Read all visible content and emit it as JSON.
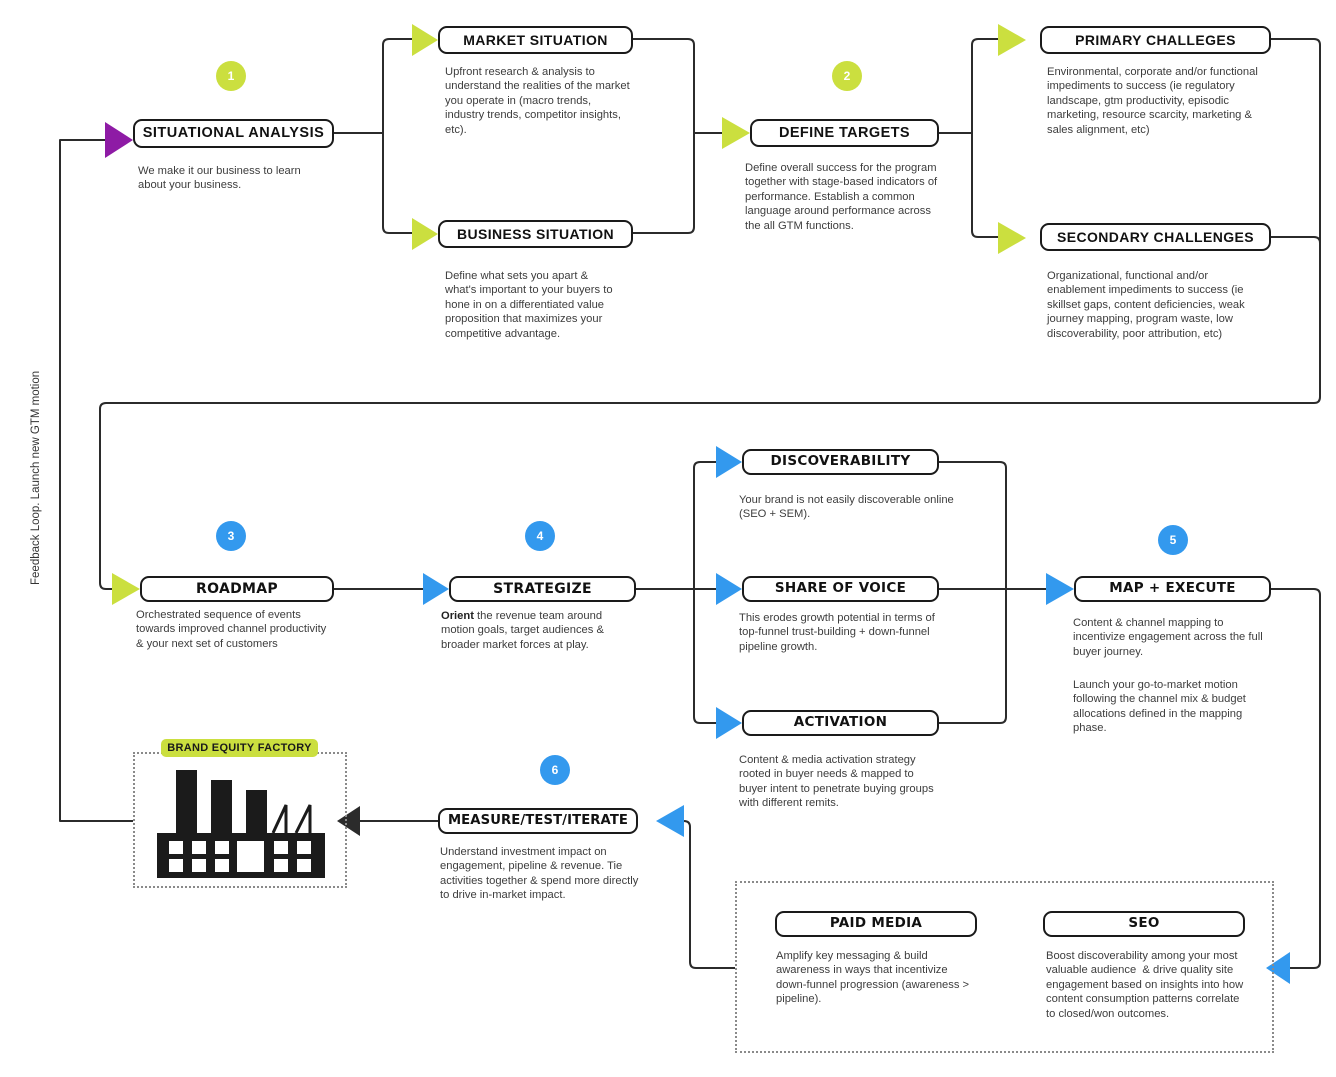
{
  "diagram": {
    "side_caption": "Feedback Loop. Launch new GTM motion",
    "accent_green": "#cbdf3f",
    "accent_blue": "#3399ee",
    "accent_purple": "#8e1ba5",
    "line_color": "#2b2b2b"
  },
  "badges": [
    {
      "id": "1",
      "label": "1",
      "color": "green"
    },
    {
      "id": "2",
      "label": "2",
      "color": "green"
    },
    {
      "id": "3",
      "label": "3",
      "color": "blue"
    },
    {
      "id": "4",
      "label": "4",
      "color": "blue"
    },
    {
      "id": "5",
      "label": "5",
      "color": "blue"
    },
    {
      "id": "6",
      "label": "6",
      "color": "blue"
    }
  ],
  "nodes": {
    "situational_analysis": {
      "title": "SITUATIONAL ANALYSIS",
      "desc": "We make it our business to learn about your business."
    },
    "market_situation": {
      "title": "MARKET SITUATION",
      "desc": "Upfront research & analysis to understand the realities of the market you operate in (macro trends, industry trends, competitor insights, etc)."
    },
    "business_situation": {
      "title": "BUSINESS SITUATION",
      "desc": "Define what sets you apart & what's important to your buyers to hone in on a differentiated value proposition that maximizes your competitive advantage."
    },
    "define_targets": {
      "title": "DEFINE TARGETS",
      "desc": "Define overall success for the program together with stage-based indicators of performance. Establish a common language around performance across the all GTM functions."
    },
    "primary_challenges": {
      "title": "PRIMARY CHALLEGES",
      "desc": "Environmental, corporate and/or functional impediments to success (ie regulatory landscape, gtm productivity, episodic marketing, resource scarcity, marketing & sales alignment, etc)"
    },
    "secondary_challenges": {
      "title": "SECONDARY CHALLENGES",
      "desc": "Organizational, functional and/or enablement impediments to success (ie skillset gaps, content deficiencies, weak journey mapping, program waste, low discoverability, poor attribution, etc)"
    },
    "roadmap": {
      "title": "ROADMAP",
      "desc": "Orchestrated sequence of events towards improved channel productivity & your next set of customers"
    },
    "strategize": {
      "title": "STRATEGIZE",
      "desc_lead": "Orient",
      "desc": " the revenue team around motion goals, target audiences & broader market forces at play."
    },
    "discoverability": {
      "title": "DISCOVERABILITY",
      "desc": "Your brand is not easily discoverable online (SEO + SEM)."
    },
    "share_of_voice": {
      "title": "SHARE OF VOICE",
      "desc": "This erodes growth potential in terms of top-funnel trust-building + down-funnel pipeline growth."
    },
    "activation": {
      "title": "ACTIVATION",
      "desc": "Content & media activation strategy rooted in buyer needs & mapped to buyer intent to penetrate buying groups with different remits."
    },
    "map_execute": {
      "title": "MAP + EXECUTE",
      "desc": "Content & channel mapping to incentivize engagement across the full buyer journey.",
      "desc2": "Launch your go-to-market motion following the channel mix & budget allocations defined in the mapping phase."
    },
    "measure_test_iterate": {
      "title": "MEASURE/TEST/ITERATE",
      "desc": "Understand investment impact on engagement, pipeline & revenue. Tie activities together & spend more directly to drive in-market impact."
    },
    "paid_media": {
      "title": "PAID MEDIA",
      "desc": "Amplify key messaging & build awareness in ways that incentivize down-funnel progression (awareness > pipeline)."
    },
    "seo": {
      "title": "SEO",
      "desc": "Boost discoverability among your most valuable audience  & drive quality site engagement based on insights into how content consumption patterns correlate to closed/won outcomes."
    }
  },
  "brand_equity_factory": {
    "label": "BRAND EQUITY FACTORY",
    "icon": "factory-icon"
  }
}
